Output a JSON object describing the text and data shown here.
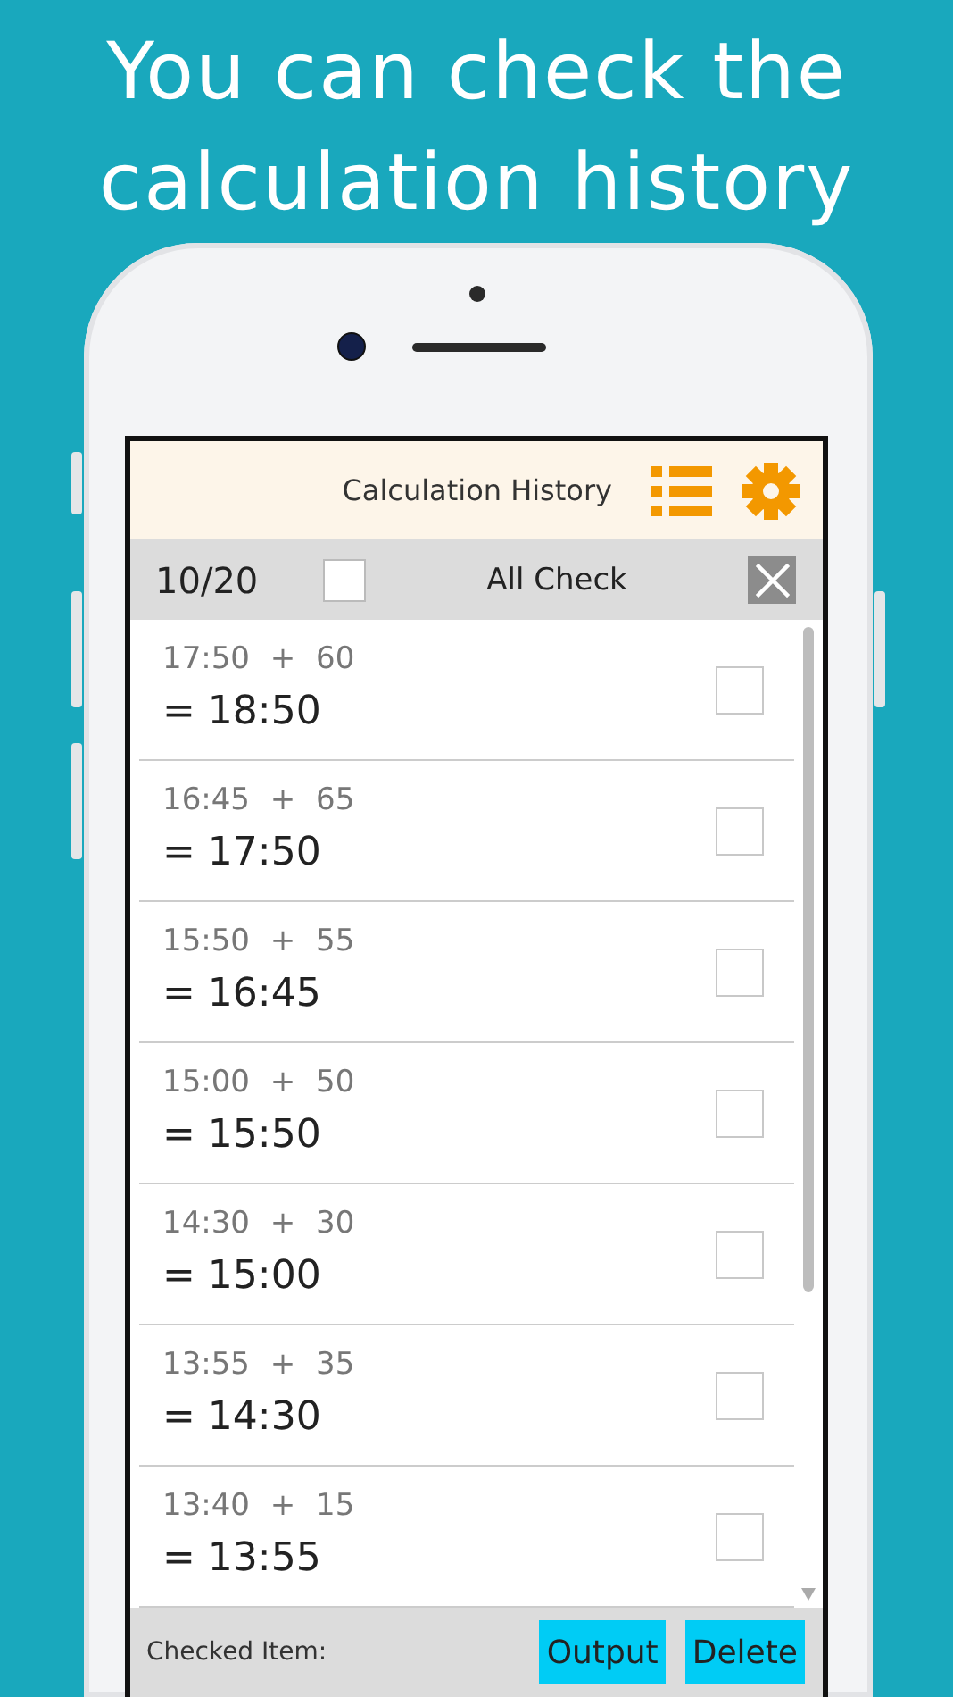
{
  "headline_lines": [
    "You can check the",
    "calculation history"
  ],
  "header": {
    "title": "Calculation History"
  },
  "toolbar": {
    "count": "10/20",
    "all_check": {
      "label": "All Check",
      "checked": false
    }
  },
  "rows": [
    {
      "expression": "17:50 + 60",
      "result": "= 18:50",
      "checked": false
    },
    {
      "expression": "16:45 + 65",
      "result": "= 17:50",
      "checked": false
    },
    {
      "expression": "15:50 + 55",
      "result": "= 16:45",
      "checked": false
    },
    {
      "expression": "15:00 + 50",
      "result": "= 15:50",
      "checked": false
    },
    {
      "expression": "14:30 + 30",
      "result": "= 15:00",
      "checked": false
    },
    {
      "expression": "13:55 + 35",
      "result": "= 14:30",
      "checked": false
    },
    {
      "expression": "13:40 + 15",
      "result": "= 13:55",
      "checked": false
    }
  ],
  "footer": {
    "label": "Checked Item:",
    "buttons": [
      "Output",
      "Delete"
    ]
  }
}
